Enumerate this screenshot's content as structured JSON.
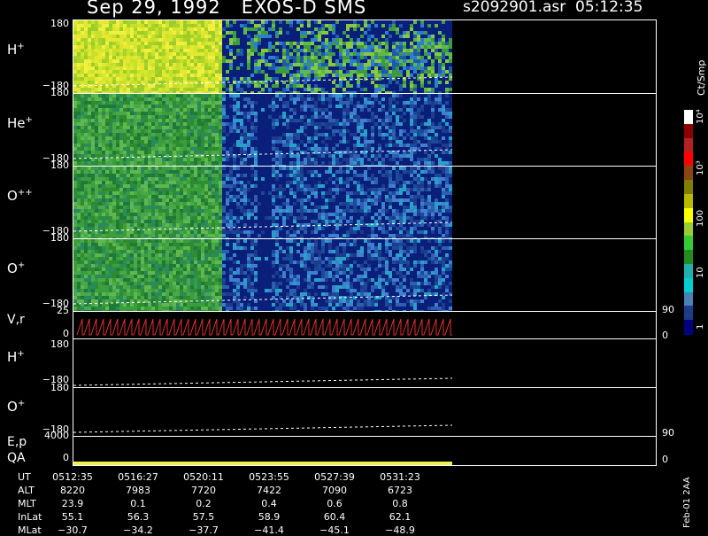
{
  "header": {
    "title": "Sep 29, 1992   EXOS-D SMS",
    "file_time": "s2092901.asr  05:12:35"
  },
  "colorbar": {
    "unit_label": "Ct/Smp",
    "tick_labels": [
      "10⁴",
      "10³",
      "100",
      "10",
      "1"
    ],
    "colors": [
      "#ffffff",
      "#8b0000",
      "#b22222",
      "#ff0000",
      "#8b4513",
      "#808000",
      "#b8b800",
      "#ffff00",
      "#9acd32",
      "#32cd32",
      "#228b22",
      "#20b2aa",
      "#00ced1",
      "#4682b4",
      "#1e3a8a",
      "#000080"
    ]
  },
  "chart_data": [
    {
      "type": "heatmap",
      "panel": "H+",
      "ylim": [
        -180,
        180
      ],
      "ytick_labels": [
        "180",
        "−180"
      ]
    },
    {
      "type": "heatmap",
      "panel": "He+",
      "ylim": [
        -180,
        180
      ],
      "ytick_labels": [
        "180",
        "−180"
      ]
    },
    {
      "type": "heatmap",
      "panel": "O++",
      "ylim": [
        -180,
        180
      ],
      "ytick_labels": [
        "180",
        "−180"
      ]
    },
    {
      "type": "heatmap",
      "panel": "O+",
      "ylim": [
        -180,
        180
      ],
      "ytick_labels": [
        "180",
        "−180"
      ]
    },
    {
      "type": "line",
      "panel": "V,r",
      "ytick_labels": [
        "25",
        "0"
      ],
      "right_ticks": [
        "90",
        "0"
      ]
    },
    {
      "type": "heatmap",
      "panel": "H+",
      "ylim": [
        -180,
        180
      ],
      "ytick_labels": [
        "180",
        "−180"
      ]
    },
    {
      "type": "heatmap",
      "panel": "O+",
      "ylim": [
        -180,
        180
      ],
      "ytick_labels": [
        "180",
        "−180"
      ]
    },
    {
      "type": "line",
      "panel": "E,p QA",
      "ytick_labels": [
        "4000",
        "0"
      ],
      "right_ticks": [
        "90",
        "0"
      ]
    }
  ],
  "panels": {
    "p1": {
      "label": "H",
      "sup": "+",
      "top": "180",
      "bot": "−180"
    },
    "p2": {
      "label": "He",
      "sup": "+",
      "top": "180",
      "bot": "−180"
    },
    "p3": {
      "label": "O",
      "sup": "++",
      "top": "180",
      "bot": "−180"
    },
    "p4": {
      "label": "O",
      "sup": "+",
      "top": "180",
      "bot": "−180"
    },
    "p5": {
      "label": "V,r",
      "top": "25",
      "bot": "0",
      "rtop": "90",
      "rbot": "0"
    },
    "p6": {
      "label": "H",
      "sup": "+",
      "top": "180",
      "bot": "−180"
    },
    "p7": {
      "label": "O",
      "sup": "+",
      "top": "180",
      "bot": "−180"
    },
    "p8": {
      "label1": "E,p",
      "label2": "QA",
      "top": "4000",
      "bot": "0",
      "rtop": "90",
      "rbot": "0"
    }
  },
  "table": {
    "rows": [
      "UT",
      "ALT",
      "MLT",
      "InLat",
      "MLat"
    ],
    "cols": [
      [
        "0512:35",
        "8220",
        "23.9",
        "55.1",
        "−30.7"
      ],
      [
        "0516:27",
        "7983",
        "0.1",
        "56.3",
        "−34.2"
      ],
      [
        "0520:11",
        "7720",
        "0.2",
        "57.5",
        "−37.7"
      ],
      [
        "0523:55",
        "7422",
        "0.4",
        "58.9",
        "−41.4"
      ],
      [
        "0527:39",
        "7090",
        "0.6",
        "60.4",
        "−45.1"
      ],
      [
        "0531:23",
        "6723",
        "0.8",
        "62.1",
        "−48.9"
      ]
    ]
  },
  "footer_code": "Feb-01 2AA"
}
